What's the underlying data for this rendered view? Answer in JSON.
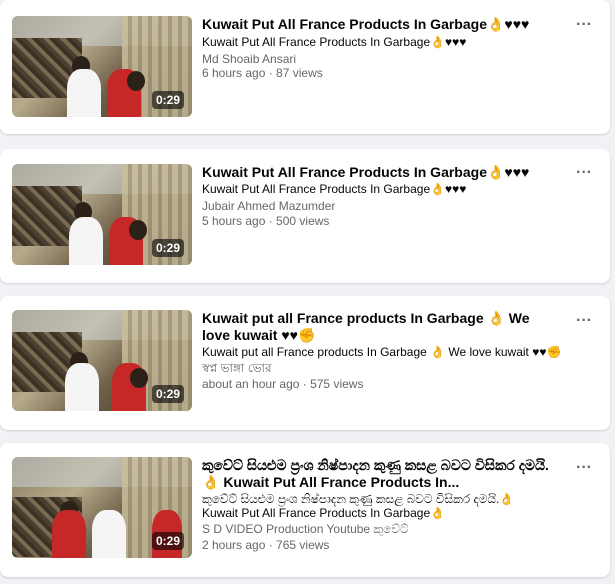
{
  "videos": [
    {
      "duration": "0:29",
      "title": "Kuwait Put All France Products In Garbage👌♥♥♥",
      "description": "Kuwait Put All France Products In Garbage👌♥♥♥",
      "author": "Md Shoaib Ansari",
      "meta": "6 hours ago · 87 views",
      "more": "···"
    },
    {
      "duration": "0:29",
      "title": "Kuwait Put All France Products In Garbage👌♥♥♥",
      "description": "Kuwait Put All France Products In Garbage👌♥♥♥",
      "author": "Jubair Ahmed Mazumder",
      "meta": "5 hours ago · 500 views",
      "more": "···"
    },
    {
      "duration": "0:29",
      "title": "Kuwait put all France products In Garbage 👌 We love kuwait ♥♥✊",
      "description": "Kuwait put all France products In Garbage 👌 We love kuwait ♥♥✊",
      "author": "স্বপ্ন ভাঙ্গা ভোর",
      "meta": "about an hour ago · 575 views",
      "more": "···"
    },
    {
      "duration": "0:29",
      "title": "කුවේට් සියළුම ප්‍රංශ නිෂ්පාදන කුණු කසළ බවට විසිකර දමයි.👌 Kuwait Put All France Products In...",
      "description": "කුවේට් සියළුම ප්‍රංශ නිෂ්පාදන කුණු කසළ බවට විසිකර දමයි.👌",
      "description2": "Kuwait Put All France Products In Garbage👌",
      "author": "S D VIDEO Production Youtube කුවේට්",
      "meta": "2 hours ago · 765 views",
      "more": "···"
    }
  ]
}
